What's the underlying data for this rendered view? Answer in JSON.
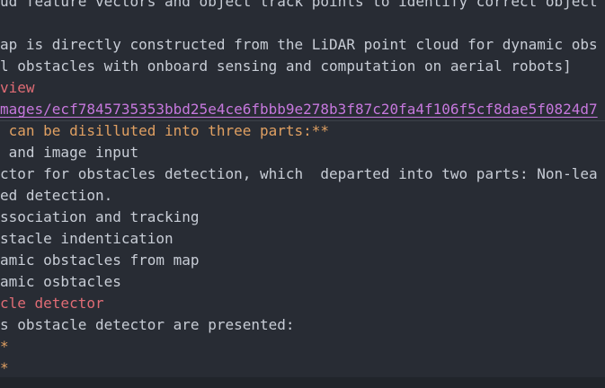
{
  "lines": [
    "ud feature vectors and object track points to identify correct object",
    "",
    "ap is directly constructed from the LiDAR point cloud for dynamic obs",
    "l obstacles with onboard sensing and computation on aerial robots]",
    "view",
    "mages/ecf7845735353bbd25e4ce6fbbb9e278b3f87c20fa4f106f5cf8dae5f0824d7",
    " can be disilluted into three parts:**",
    " and image input",
    "ctor for obstacles detection, which  departed into two parts: Non-lea",
    "ed detection.",
    "ssociation and tracking",
    "stacle indentication",
    "amic obstacles from map",
    "amic osbtacles",
    "cle detector",
    "s obstacle detector are presented:",
    "*",
    "*",
    "**"
  ],
  "colors": {
    "background": "#282c34",
    "text": "#c8cdd6",
    "heading": "#e0a062",
    "section": "#e06c75",
    "link": "#c678dd"
  }
}
